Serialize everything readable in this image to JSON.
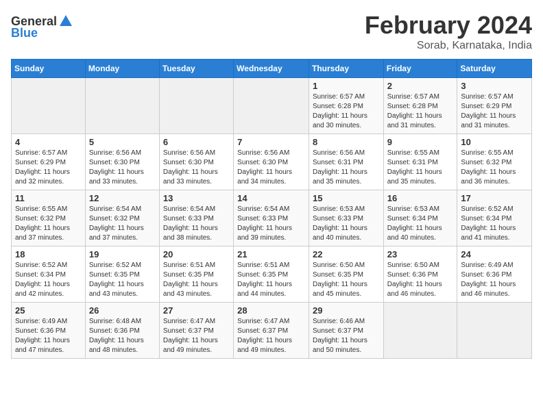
{
  "header": {
    "logo_general": "General",
    "logo_blue": "Blue",
    "month_title": "February 2024",
    "location": "Sorab, Karnataka, India"
  },
  "columns": [
    "Sunday",
    "Monday",
    "Tuesday",
    "Wednesday",
    "Thursday",
    "Friday",
    "Saturday"
  ],
  "weeks": [
    [
      {
        "day": "",
        "empty": true
      },
      {
        "day": "",
        "empty": true
      },
      {
        "day": "",
        "empty": true
      },
      {
        "day": "",
        "empty": true
      },
      {
        "day": "1",
        "sunrise": "6:57 AM",
        "sunset": "6:28 PM",
        "daylight": "11 hours and 30 minutes."
      },
      {
        "day": "2",
        "sunrise": "6:57 AM",
        "sunset": "6:28 PM",
        "daylight": "11 hours and 31 minutes."
      },
      {
        "day": "3",
        "sunrise": "6:57 AM",
        "sunset": "6:29 PM",
        "daylight": "11 hours and 31 minutes."
      }
    ],
    [
      {
        "day": "4",
        "sunrise": "6:57 AM",
        "sunset": "6:29 PM",
        "daylight": "11 hours and 32 minutes."
      },
      {
        "day": "5",
        "sunrise": "6:56 AM",
        "sunset": "6:30 PM",
        "daylight": "11 hours and 33 minutes."
      },
      {
        "day": "6",
        "sunrise": "6:56 AM",
        "sunset": "6:30 PM",
        "daylight": "11 hours and 33 minutes."
      },
      {
        "day": "7",
        "sunrise": "6:56 AM",
        "sunset": "6:30 PM",
        "daylight": "11 hours and 34 minutes."
      },
      {
        "day": "8",
        "sunrise": "6:56 AM",
        "sunset": "6:31 PM",
        "daylight": "11 hours and 35 minutes."
      },
      {
        "day": "9",
        "sunrise": "6:55 AM",
        "sunset": "6:31 PM",
        "daylight": "11 hours and 35 minutes."
      },
      {
        "day": "10",
        "sunrise": "6:55 AM",
        "sunset": "6:32 PM",
        "daylight": "11 hours and 36 minutes."
      }
    ],
    [
      {
        "day": "11",
        "sunrise": "6:55 AM",
        "sunset": "6:32 PM",
        "daylight": "11 hours and 37 minutes."
      },
      {
        "day": "12",
        "sunrise": "6:54 AM",
        "sunset": "6:32 PM",
        "daylight": "11 hours and 37 minutes."
      },
      {
        "day": "13",
        "sunrise": "6:54 AM",
        "sunset": "6:33 PM",
        "daylight": "11 hours and 38 minutes."
      },
      {
        "day": "14",
        "sunrise": "6:54 AM",
        "sunset": "6:33 PM",
        "daylight": "11 hours and 39 minutes."
      },
      {
        "day": "15",
        "sunrise": "6:53 AM",
        "sunset": "6:33 PM",
        "daylight": "11 hours and 40 minutes."
      },
      {
        "day": "16",
        "sunrise": "6:53 AM",
        "sunset": "6:34 PM",
        "daylight": "11 hours and 40 minutes."
      },
      {
        "day": "17",
        "sunrise": "6:52 AM",
        "sunset": "6:34 PM",
        "daylight": "11 hours and 41 minutes."
      }
    ],
    [
      {
        "day": "18",
        "sunrise": "6:52 AM",
        "sunset": "6:34 PM",
        "daylight": "11 hours and 42 minutes."
      },
      {
        "day": "19",
        "sunrise": "6:52 AM",
        "sunset": "6:35 PM",
        "daylight": "11 hours and 43 minutes."
      },
      {
        "day": "20",
        "sunrise": "6:51 AM",
        "sunset": "6:35 PM",
        "daylight": "11 hours and 43 minutes."
      },
      {
        "day": "21",
        "sunrise": "6:51 AM",
        "sunset": "6:35 PM",
        "daylight": "11 hours and 44 minutes."
      },
      {
        "day": "22",
        "sunrise": "6:50 AM",
        "sunset": "6:35 PM",
        "daylight": "11 hours and 45 minutes."
      },
      {
        "day": "23",
        "sunrise": "6:50 AM",
        "sunset": "6:36 PM",
        "daylight": "11 hours and 46 minutes."
      },
      {
        "day": "24",
        "sunrise": "6:49 AM",
        "sunset": "6:36 PM",
        "daylight": "11 hours and 46 minutes."
      }
    ],
    [
      {
        "day": "25",
        "sunrise": "6:49 AM",
        "sunset": "6:36 PM",
        "daylight": "11 hours and 47 minutes."
      },
      {
        "day": "26",
        "sunrise": "6:48 AM",
        "sunset": "6:36 PM",
        "daylight": "11 hours and 48 minutes."
      },
      {
        "day": "27",
        "sunrise": "6:47 AM",
        "sunset": "6:37 PM",
        "daylight": "11 hours and 49 minutes."
      },
      {
        "day": "28",
        "sunrise": "6:47 AM",
        "sunset": "6:37 PM",
        "daylight": "11 hours and 49 minutes."
      },
      {
        "day": "29",
        "sunrise": "6:46 AM",
        "sunset": "6:37 PM",
        "daylight": "11 hours and 50 minutes."
      },
      {
        "day": "",
        "empty": true
      },
      {
        "day": "",
        "empty": true
      }
    ]
  ]
}
